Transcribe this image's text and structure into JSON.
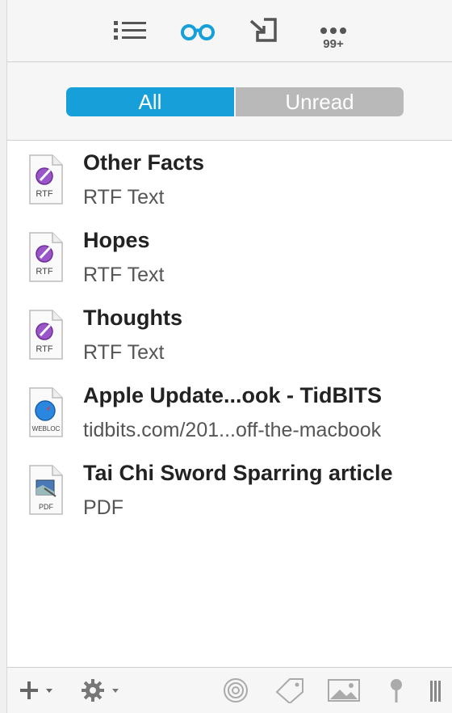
{
  "toolbar": {
    "icons": [
      "list-icon",
      "reading-glasses-icon",
      "import-arrow-icon",
      "more-icon"
    ],
    "badge": "99+",
    "accent": "#169fd9"
  },
  "filter": {
    "all_label": "All",
    "unread_label": "Unread",
    "selected": "All"
  },
  "items": [
    {
      "title": "Other Facts",
      "subtitle": "RTF Text",
      "icon_label": "RTF",
      "icon": "rtf-document-icon"
    },
    {
      "title": "Hopes",
      "subtitle": "RTF Text",
      "icon_label": "RTF",
      "icon": "rtf-document-icon"
    },
    {
      "title": "Thoughts",
      "subtitle": "RTF Text",
      "icon_label": "RTF",
      "icon": "rtf-document-icon"
    },
    {
      "title": "Apple Update...ook - TidBITS",
      "subtitle": "tidbits.com/201...off-the-macbook",
      "icon_label": "WEBLOC",
      "icon": "webloc-document-icon"
    },
    {
      "title": "Tai Chi Sword Sparring article",
      "subtitle": "PDF",
      "icon_label": "PDF",
      "icon": "pdf-document-icon"
    }
  ],
  "bottom": {
    "icons": [
      "add-icon",
      "gear-icon",
      "target-icon",
      "tag-icon",
      "image-icon",
      "pin-icon",
      "columns-icon"
    ]
  }
}
